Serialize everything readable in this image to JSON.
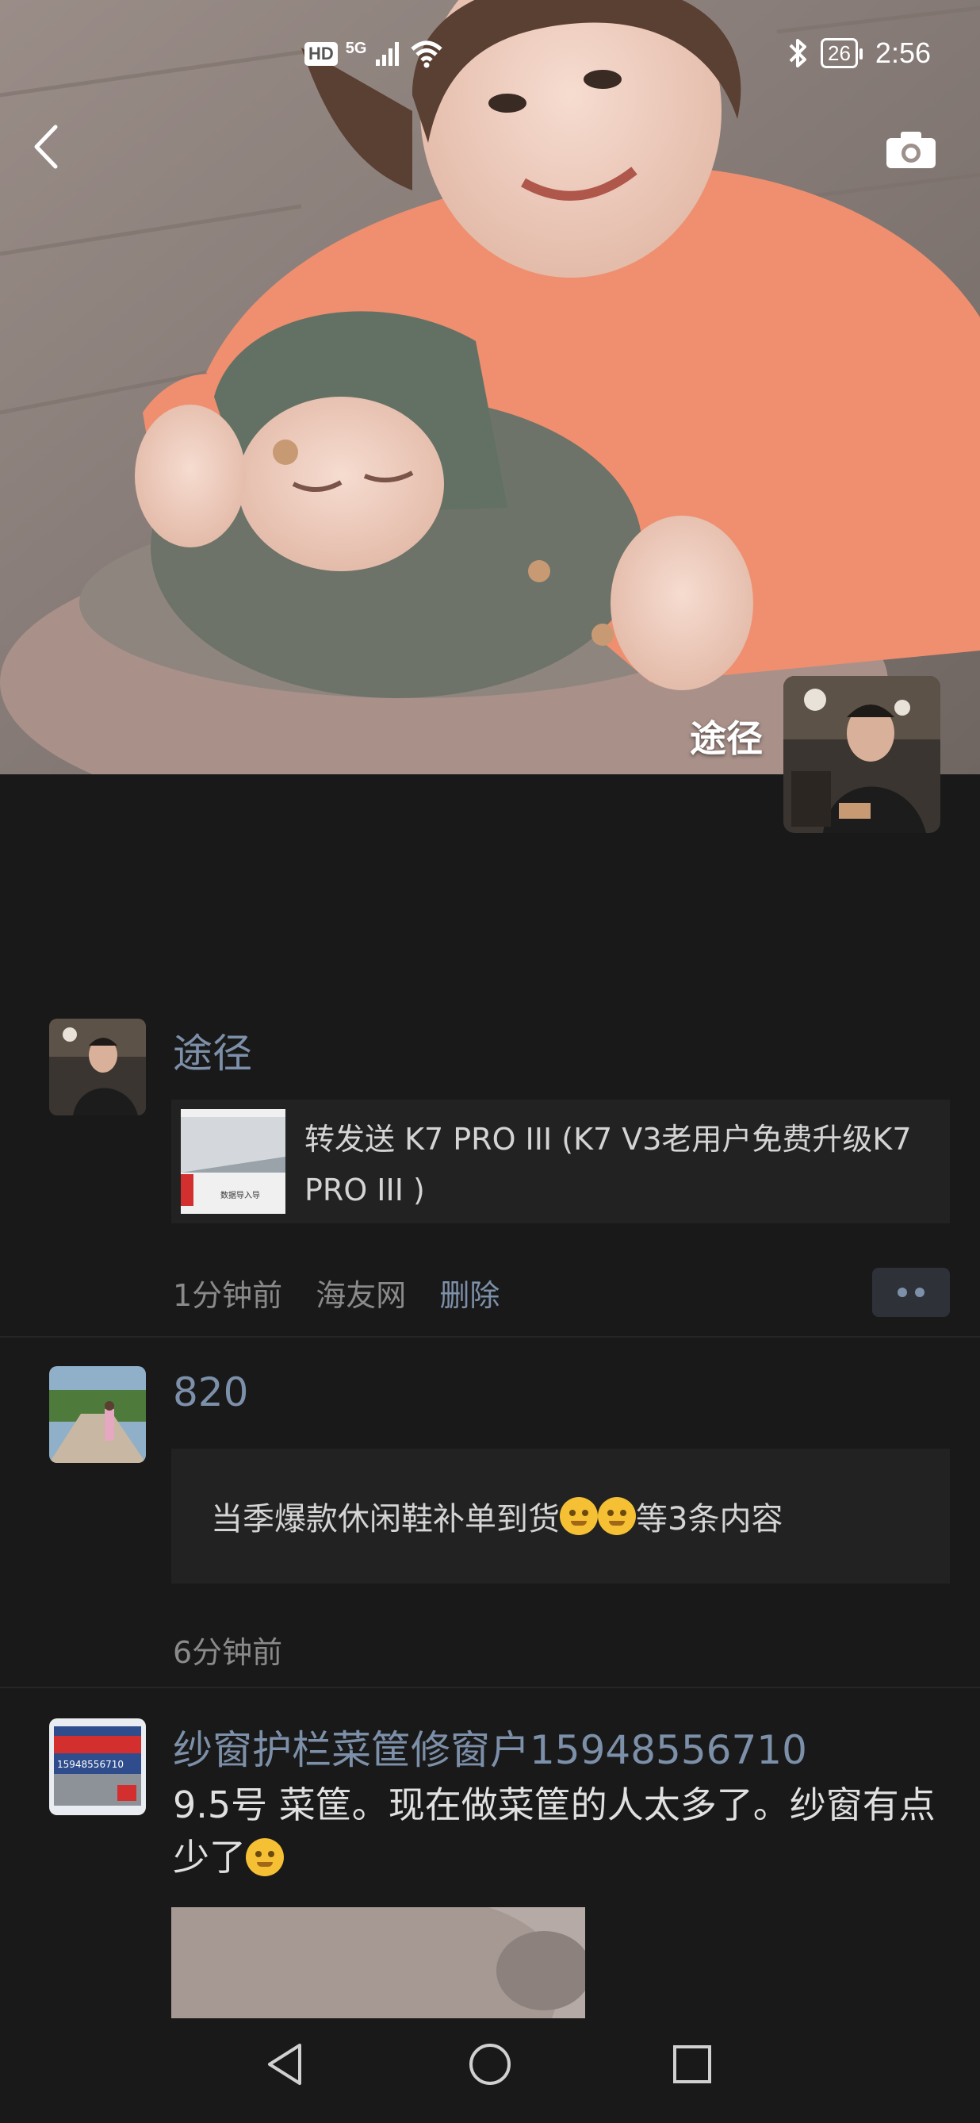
{
  "status_bar": {
    "hd": "HD",
    "network": "5G",
    "battery": "26",
    "time": "2:56"
  },
  "header": {
    "back_icon": "chevron-left-icon",
    "camera_icon": "camera-icon"
  },
  "profile": {
    "name": "途径"
  },
  "feed": [
    {
      "username": "途径",
      "share_text": "转发送 K7 PRO III (K7 V3老用户免费升级K7 PRO III )",
      "share_thumb_caption": "数据导入导",
      "time": "1分钟前",
      "source": "海友网",
      "delete_label": "删除"
    },
    {
      "username": "820",
      "card_text_before": "当季爆款休闲鞋补单到货",
      "card_text_after": "等3条内容",
      "time": "6分钟前"
    },
    {
      "username": "纱窗护栏菜筐修窗户15948556710",
      "text_before": "9.5号 菜筐。现在做菜筐的人太多了。纱窗有点少了",
      "avatar_text": "15948556710"
    }
  ],
  "colors": {
    "background": "#191919",
    "link": "#7d90a9",
    "card": "#222222"
  }
}
